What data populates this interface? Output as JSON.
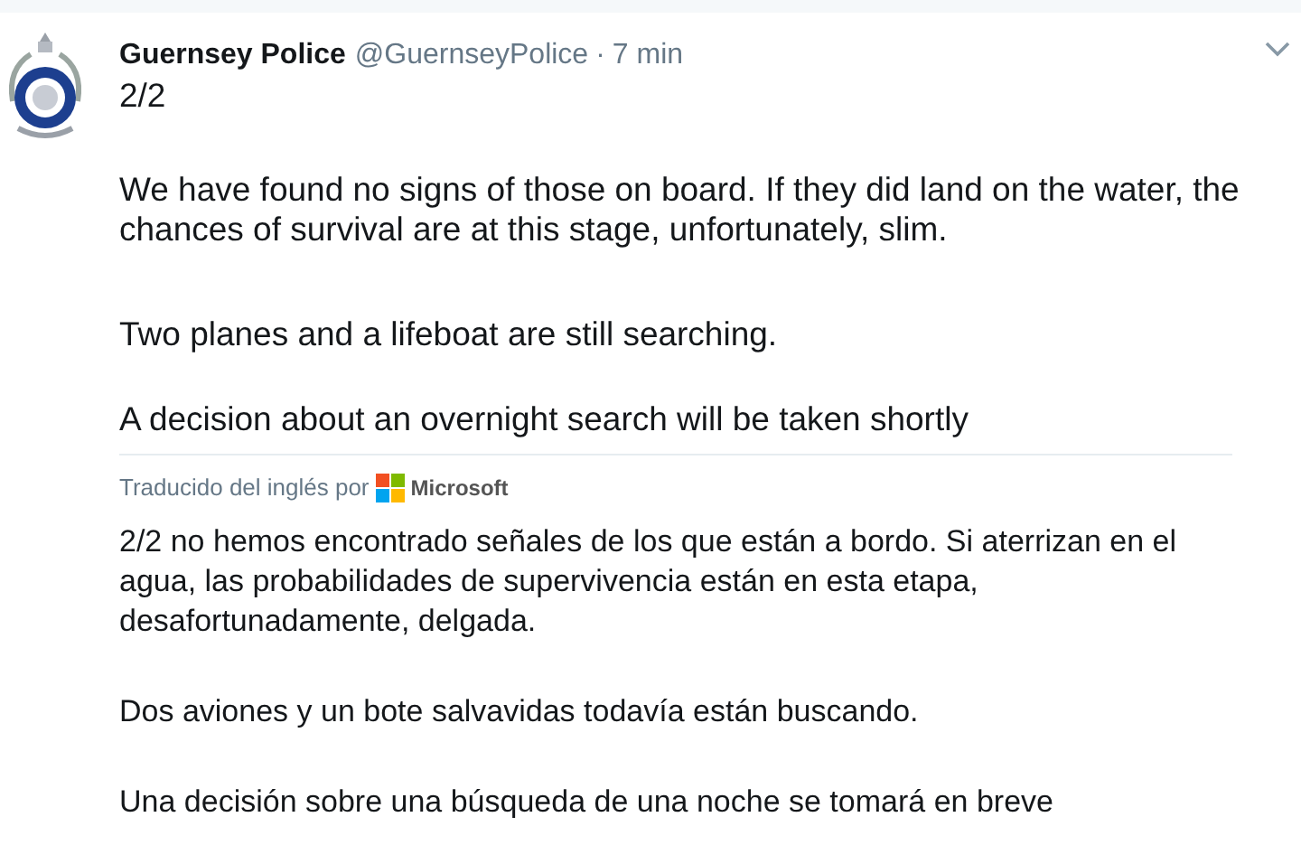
{
  "tweet": {
    "author_name": "Guernsey Police",
    "handle": "@GuernseyPolice",
    "separator": "·",
    "time": "7 min",
    "paragraphs": [
      "2/2",
      "We have found no signs of those on board. If they did land on the water, the chances of survival are at this stage, unfortunately, slim.",
      "Two planes and a lifeboat are still searching.",
      "A decision about an overnight search will be taken shortly"
    ],
    "translation": {
      "label": "Traducido del inglés por",
      "provider": "Microsoft",
      "paragraphs": [
        "2/2 no hemos encontrado señales de los que están a bordo. Si aterrizan en el agua, las probabilidades de supervivencia están en esta etapa, desafortunadamente, delgada.",
        "Dos aviones y un bote salvavidas todavía están buscando.",
        "Una decisión sobre una búsqueda de una noche se tomará en breve"
      ]
    }
  }
}
